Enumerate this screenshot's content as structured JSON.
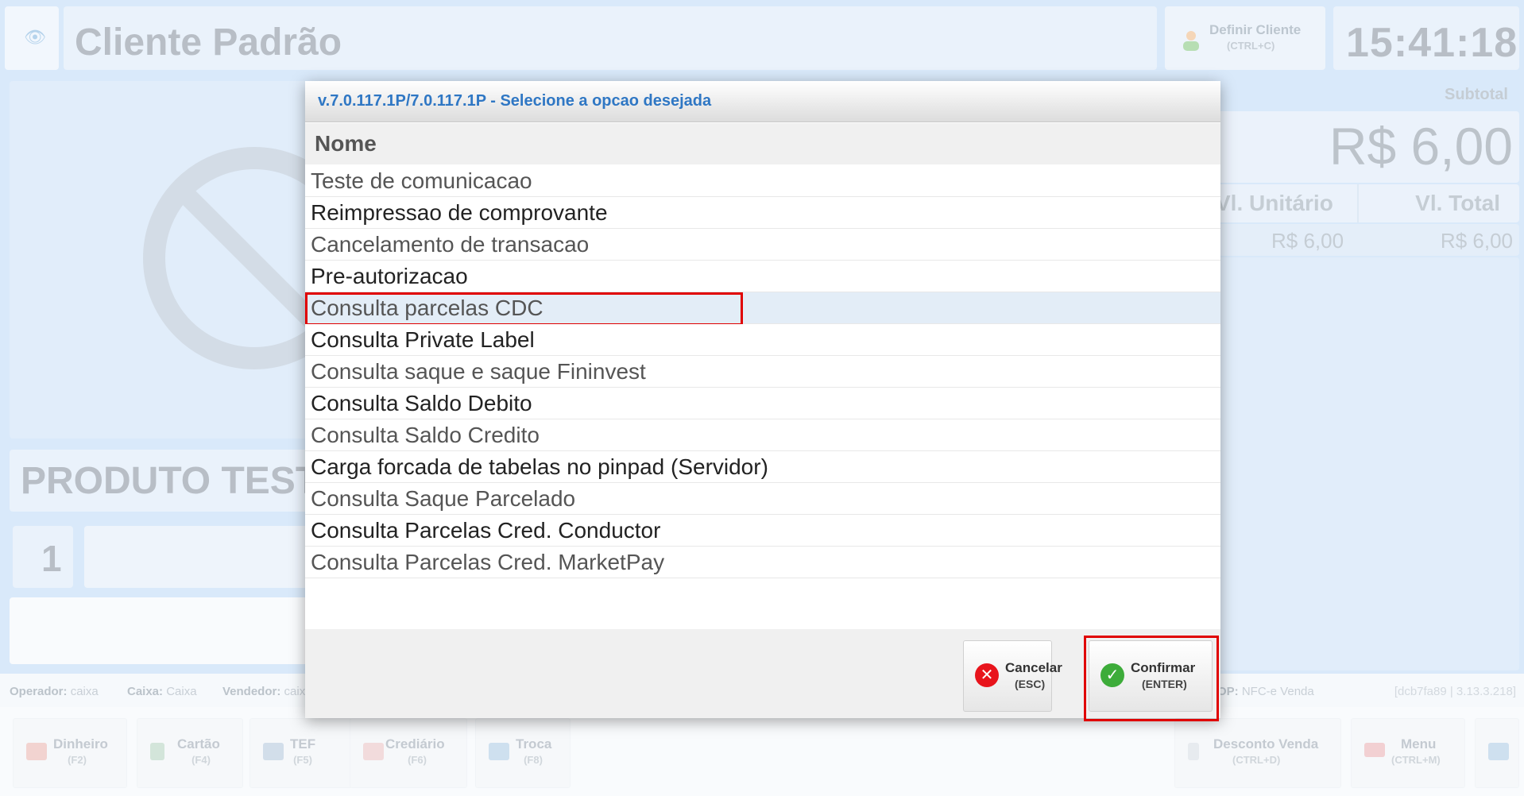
{
  "app": {
    "client_name": "Cliente Padrão",
    "define_client_label": "Definir Cliente",
    "define_client_shortcut": "(CTRL+C)",
    "clock": "15:41:18",
    "product_name": "PRODUTO TESTE",
    "quantity": "1",
    "subtotal_label": "Subtotal",
    "subtotal_value": "R$ 6,00",
    "unit_label": "Vl. Unitário",
    "total_label": "Vl. Total",
    "unit_value": "R$ 6,00",
    "total_value": "R$ 6,00"
  },
  "statusbar": {
    "operator_label": "Operador:",
    "operator_value": "caixa",
    "cashier_label": "Caixa:",
    "cashier_value": "Caixa",
    "seller_label": "Vendedor:",
    "seller_value": "caixa",
    "op_label": "OP:",
    "op_value": "NFC-e Venda",
    "version": "[dcb7fa89 | 3.13.3.218]"
  },
  "toolbar": {
    "buttons": [
      {
        "label": "Dinheiro",
        "shortcut": "(F2)"
      },
      {
        "label": "Cartão",
        "shortcut": "(F4)"
      },
      {
        "label": "TEF",
        "shortcut": "(F5)"
      },
      {
        "label": "Crediário",
        "shortcut": "(F6)"
      },
      {
        "label": "Troca",
        "shortcut": "(F8)"
      },
      {
        "label": "Desconto Venda",
        "shortcut": "(CTRL+D)"
      },
      {
        "label": "Menu",
        "shortcut": "(CTRL+M)"
      }
    ]
  },
  "dialog": {
    "title": "v.7.0.117.1P/7.0.117.1P - Selecione a opcao desejada",
    "column_header": "Nome",
    "options": [
      "Teste de comunicacao",
      "Reimpressao de comprovante",
      "Cancelamento de transacao",
      "Pre-autorizacao",
      "Consulta parcelas CDC",
      "Consulta Private Label",
      "Consulta saque e saque Fininvest",
      "Consulta Saldo Debito",
      "Consulta Saldo Credito",
      "Carga forcada de tabelas no pinpad (Servidor)",
      "Consulta Saque Parcelado",
      "Consulta Parcelas Cred. Conductor",
      "Consulta Parcelas Cred. MarketPay"
    ],
    "selected_index": 4,
    "cancel_label": "Cancelar",
    "cancel_shortcut": "(ESC)",
    "confirm_label": "Confirmar",
    "confirm_shortcut": "(ENTER)"
  },
  "colors": {
    "title_blue": "#2f77c4",
    "highlight_red": "#e00000",
    "cancel_red": "#e8141c",
    "confirm_green": "#3dac3a"
  }
}
